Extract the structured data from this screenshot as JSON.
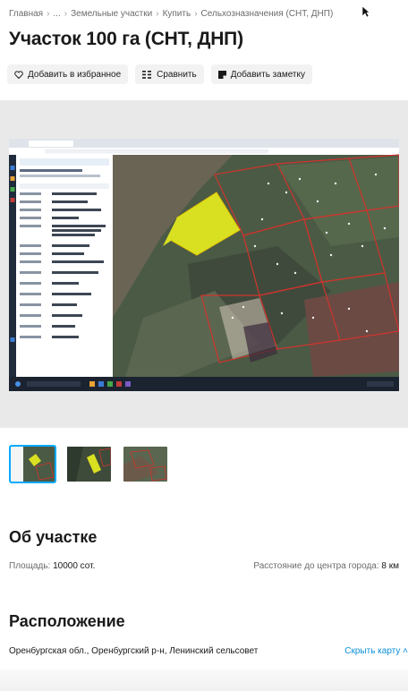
{
  "breadcrumb": [
    "Главная",
    "...",
    "Земельные участки",
    "Купить",
    "Сельхозназначения (СНТ, ДНП)"
  ],
  "title": "Участок 100 га (СНТ, ДНП)",
  "actions": {
    "favorite": "Добавить в избранное",
    "compare": "Сравнить",
    "note": "Добавить заметку"
  },
  "gallery": {
    "accent_color": "#00aaff",
    "plot_color": "#d9e021",
    "boundary_color": "#d0342c"
  },
  "about": {
    "heading": "Об участке",
    "area_label": "Площадь:",
    "area_value": "10000 сот.",
    "distance_label": "Расстояние до центра города:",
    "distance_value": "8 км"
  },
  "location": {
    "heading": "Расположение",
    "address": "Оренбургская обл., Оренбургский р-н, Ленинский сельсовет",
    "hide_map": "Скрыть карту"
  }
}
